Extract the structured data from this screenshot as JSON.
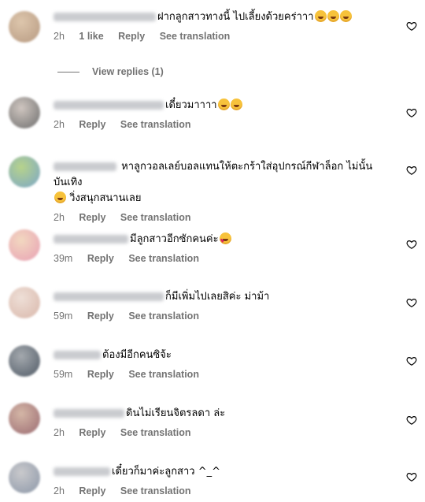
{
  "comments": [
    {
      "text": "ฝากลูกสาวทางนี้ ไปเลี้ยงด้วยคร่าาา",
      "emojis": [
        "grin",
        "grin",
        "grin"
      ],
      "time": "2h",
      "likes": "1 like",
      "reply": "Reply",
      "translate": "See translation",
      "username_width": 130,
      "avatar_colors": [
        "#b79a82",
        "#ddc6ac"
      ]
    },
    {
      "text": "เดี๋ยวมาาาา",
      "emojis": [
        "wink",
        "smile"
      ],
      "time": "2h",
      "reply": "Reply",
      "translate": "See translation",
      "username_width": 140,
      "avatar_colors": [
        "#6d6d6d",
        "#cfc6c0"
      ]
    },
    {
      "text": "หาลูกวอลเลย์บอลแทนให้ตะกร้าใส่อุปกรณ์กีฬาล็อก ไม่นั้นบันเทิง",
      "text2": "วิ่งสนุกสนานเลย",
      "emojis": [
        "grin"
      ],
      "time": "2h",
      "reply": "Reply",
      "translate": "See translation",
      "username_width": 80,
      "avatar_colors": [
        "#7aa6c9",
        "#b7d38b"
      ]
    },
    {
      "text": "มีลูกสาวอีกซักคนค่ะ",
      "emojis": [
        "hearteyes"
      ],
      "time": "39m",
      "reply": "Reply",
      "translate": "See translation",
      "username_width": 95,
      "avatar_colors": [
        "#e8a0b4",
        "#f2d8c0"
      ]
    },
    {
      "text": "ก็มีเพิ่มไปเลยสิค่ะ ม่าม้า",
      "emojis": [],
      "time": "59m",
      "reply": "Reply",
      "translate": "See translation",
      "username_width": 140,
      "avatar_colors": [
        "#d9b7aa",
        "#eedfd7"
      ]
    },
    {
      "text": "ต้องมีอีกคนซิจ้ะ",
      "emojis": [],
      "time": "59m",
      "reply": "Reply",
      "translate": "See translation",
      "username_width": 60,
      "avatar_colors": [
        "#505a66",
        "#a4a9ae"
      ]
    },
    {
      "text": "ดินไม่เรียนจิตรลดา ล่ะ",
      "emojis": [],
      "time": "2h",
      "reply": "Reply",
      "translate": "See translation",
      "username_width": 90,
      "avatar_colors": [
        "#9b6b72",
        "#d4b6a6"
      ]
    },
    {
      "text": "เดี๋ยวก็มาค่ะลูกสาว ^_^",
      "emojis": [],
      "time": "2h",
      "reply": "Reply",
      "translate": "See translation",
      "username_width": 72,
      "avatar_colors": [
        "#8c97a8",
        "#c9c9cc"
      ]
    }
  ],
  "view_replies": "View replies (1)",
  "colors": {
    "meta": "#737373",
    "background": "#ffffff",
    "text": "#000000"
  }
}
